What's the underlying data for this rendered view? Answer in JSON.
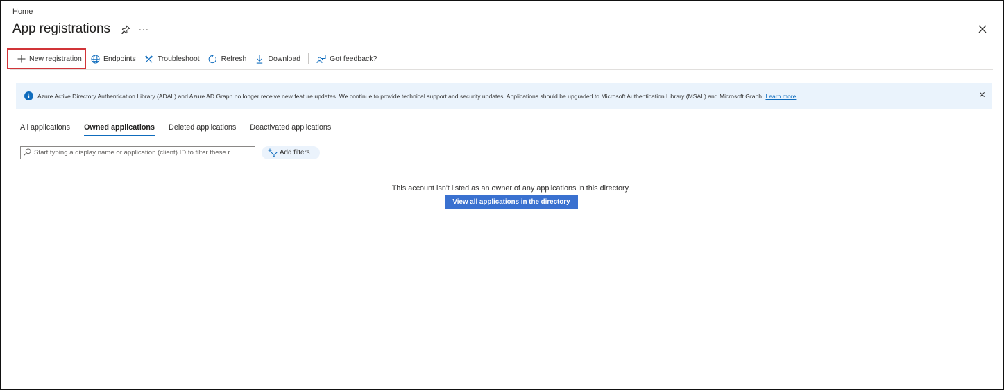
{
  "breadcrumb": {
    "home": "Home"
  },
  "header": {
    "title": "App registrations",
    "more": "···"
  },
  "toolbar": {
    "new_registration": "New registration",
    "endpoints": "Endpoints",
    "troubleshoot": "Troubleshoot",
    "refresh": "Refresh",
    "download": "Download",
    "feedback": "Got feedback?"
  },
  "banner": {
    "text": "Azure Active Directory Authentication Library (ADAL) and Azure AD Graph no longer receive new feature updates. We continue to provide technical support and security updates. Applications should be upgraded to Microsoft Authentication Library (MSAL) and Microsoft Graph.",
    "link": "Learn more"
  },
  "tabs": [
    {
      "label": "All applications",
      "active": false
    },
    {
      "label": "Owned applications",
      "active": true
    },
    {
      "label": "Deleted applications",
      "active": false
    },
    {
      "label": "Deactivated applications",
      "active": false
    }
  ],
  "filter": {
    "search_placeholder": "Start typing a display name or application (client) ID to filter these r...",
    "add_filters": "Add filters"
  },
  "empty_state": {
    "message": "This account isn't listed as an owner of any applications in this directory.",
    "button": "View all applications in the directory"
  },
  "colors": {
    "accent": "#0f6cbd",
    "primary_button": "#3a71d0",
    "banner_bg": "#eaf3fc",
    "highlight_border": "#d13438"
  }
}
